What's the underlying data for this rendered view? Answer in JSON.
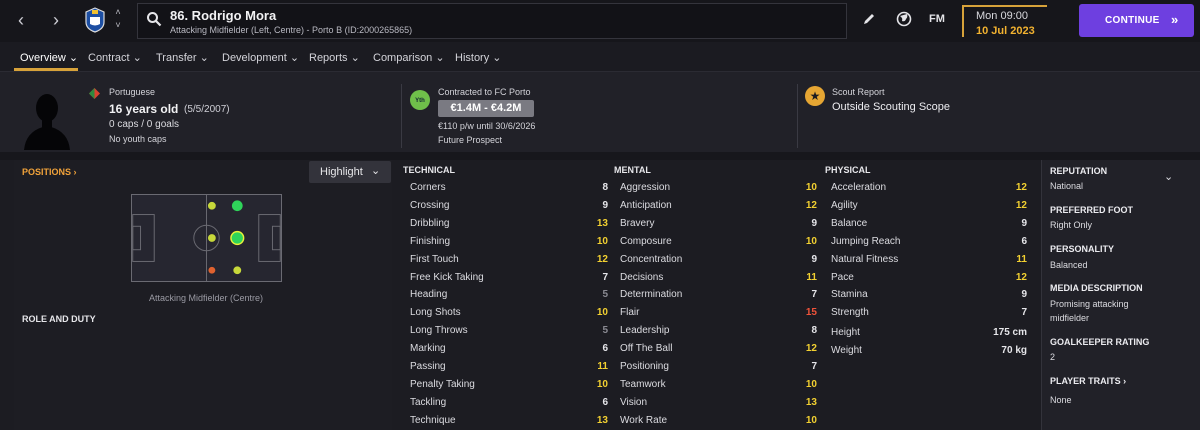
{
  "nav": {
    "back": "‹",
    "forward": "›",
    "up": "˄",
    "down": "˅"
  },
  "player": {
    "name": "86. Rodrigo Mora",
    "subtitle": "Attacking Midfielder (Left, Centre) - Porto B (ID:2000265865)"
  },
  "toolbar": {
    "fm": "FM",
    "day": "Mon 09:00",
    "date": "10 Jul 2023",
    "continue": "CONTINUE",
    "continue_arrow": "»"
  },
  "tabs": [
    {
      "label": "Overview ⌄",
      "active": true
    },
    {
      "label": "Contract ⌄"
    },
    {
      "label": "Transfer ⌄"
    },
    {
      "label": "Development ⌄"
    },
    {
      "label": "Reports ⌄"
    },
    {
      "label": "Comparison ⌄"
    },
    {
      "label": "History ⌄"
    }
  ],
  "profile": {
    "nationality": "Portuguese",
    "age": "16 years old",
    "dob": "(5/5/2007)",
    "caps": "0 caps / 0 goals",
    "youth": "No youth caps"
  },
  "contract": {
    "label": "Contracted to FC Porto",
    "value": "€1.4M - €4.2M",
    "wage": "€110 p/w until 30/6/2026",
    "status": "Future Prospect",
    "badge": "Yth"
  },
  "scout": {
    "label": "Scout Report",
    "value": "Outside Scouting Scope"
  },
  "positions": {
    "label": "POSITIONS ›",
    "highlight": "Highlight",
    "caption": "Attacking Midfielder (Centre)",
    "role": "ROLE AND DUTY"
  },
  "technical": {
    "title": "TECHNICAL",
    "items": [
      {
        "name": "Corners",
        "value": "8",
        "color": "#e6e6ea"
      },
      {
        "name": "Crossing",
        "value": "9",
        "color": "#e6e6ea"
      },
      {
        "name": "Dribbling",
        "value": "13",
        "color": "#f2d031"
      },
      {
        "name": "Finishing",
        "value": "10",
        "color": "#f2d031"
      },
      {
        "name": "First Touch",
        "value": "12",
        "color": "#f2d031"
      },
      {
        "name": "Free Kick Taking",
        "value": "7",
        "color": "#e6e6ea"
      },
      {
        "name": "Heading",
        "value": "5",
        "color": "#8a8a92"
      },
      {
        "name": "Long Shots",
        "value": "10",
        "color": "#f2d031"
      },
      {
        "name": "Long Throws",
        "value": "5",
        "color": "#8a8a92"
      },
      {
        "name": "Marking",
        "value": "6",
        "color": "#e6e6ea"
      },
      {
        "name": "Passing",
        "value": "11",
        "color": "#f2d031"
      },
      {
        "name": "Penalty Taking",
        "value": "10",
        "color": "#f2d031"
      },
      {
        "name": "Tackling",
        "value": "6",
        "color": "#e6e6ea"
      },
      {
        "name": "Technique",
        "value": "13",
        "color": "#f2d031"
      }
    ]
  },
  "mental": {
    "title": "MENTAL",
    "items": [
      {
        "name": "Aggression",
        "value": "10",
        "color": "#f2d031"
      },
      {
        "name": "Anticipation",
        "value": "12",
        "color": "#f2d031"
      },
      {
        "name": "Bravery",
        "value": "9",
        "color": "#e6e6ea"
      },
      {
        "name": "Composure",
        "value": "10",
        "color": "#f2d031"
      },
      {
        "name": "Concentration",
        "value": "9",
        "color": "#e6e6ea"
      },
      {
        "name": "Decisions",
        "value": "11",
        "color": "#f2d031"
      },
      {
        "name": "Determination",
        "value": "7",
        "color": "#e6e6ea"
      },
      {
        "name": "Flair",
        "value": "15",
        "color": "#f0533a"
      },
      {
        "name": "Leadership",
        "value": "8",
        "color": "#e6e6ea"
      },
      {
        "name": "Off The Ball",
        "value": "12",
        "color": "#f2d031"
      },
      {
        "name": "Positioning",
        "value": "7",
        "color": "#e6e6ea"
      },
      {
        "name": "Teamwork",
        "value": "10",
        "color": "#f2d031"
      },
      {
        "name": "Vision",
        "value": "13",
        "color": "#f2d031"
      },
      {
        "name": "Work Rate",
        "value": "10",
        "color": "#f2d031"
      }
    ]
  },
  "physical": {
    "title": "PHYSICAL",
    "items": [
      {
        "name": "Acceleration",
        "value": "12",
        "color": "#f2d031"
      },
      {
        "name": "Agility",
        "value": "12",
        "color": "#f2d031"
      },
      {
        "name": "Balance",
        "value": "9",
        "color": "#e6e6ea"
      },
      {
        "name": "Jumping Reach",
        "value": "6",
        "color": "#e6e6ea"
      },
      {
        "name": "Natural Fitness",
        "value": "11",
        "color": "#f2d031"
      },
      {
        "name": "Pace",
        "value": "12",
        "color": "#f2d031"
      },
      {
        "name": "Stamina",
        "value": "9",
        "color": "#e6e6ea"
      },
      {
        "name": "Strength",
        "value": "7",
        "color": "#e6e6ea"
      }
    ],
    "height_label": "Height",
    "height": "175 cm",
    "weight_label": "Weight",
    "weight": "70 kg"
  },
  "side": {
    "reputation_label": "REPUTATION",
    "reputation": "National",
    "foot_label": "PREFERRED FOOT",
    "foot": "Right Only",
    "personality_label": "PERSONALITY",
    "personality": "Balanced",
    "media_label": "MEDIA DESCRIPTION",
    "media_1": "Promising attacking",
    "media_2": "midfielder",
    "gk_label": "GOALKEEPER RATING",
    "gk": "2",
    "traits_label": "PLAYER TRAITS ›",
    "traits": "None"
  },
  "colors": {
    "accent": "#d7a23a",
    "continue": "#6e3fe0",
    "good": "#f2d031",
    "great": "#f0533a",
    "dim": "#8a8a92"
  }
}
